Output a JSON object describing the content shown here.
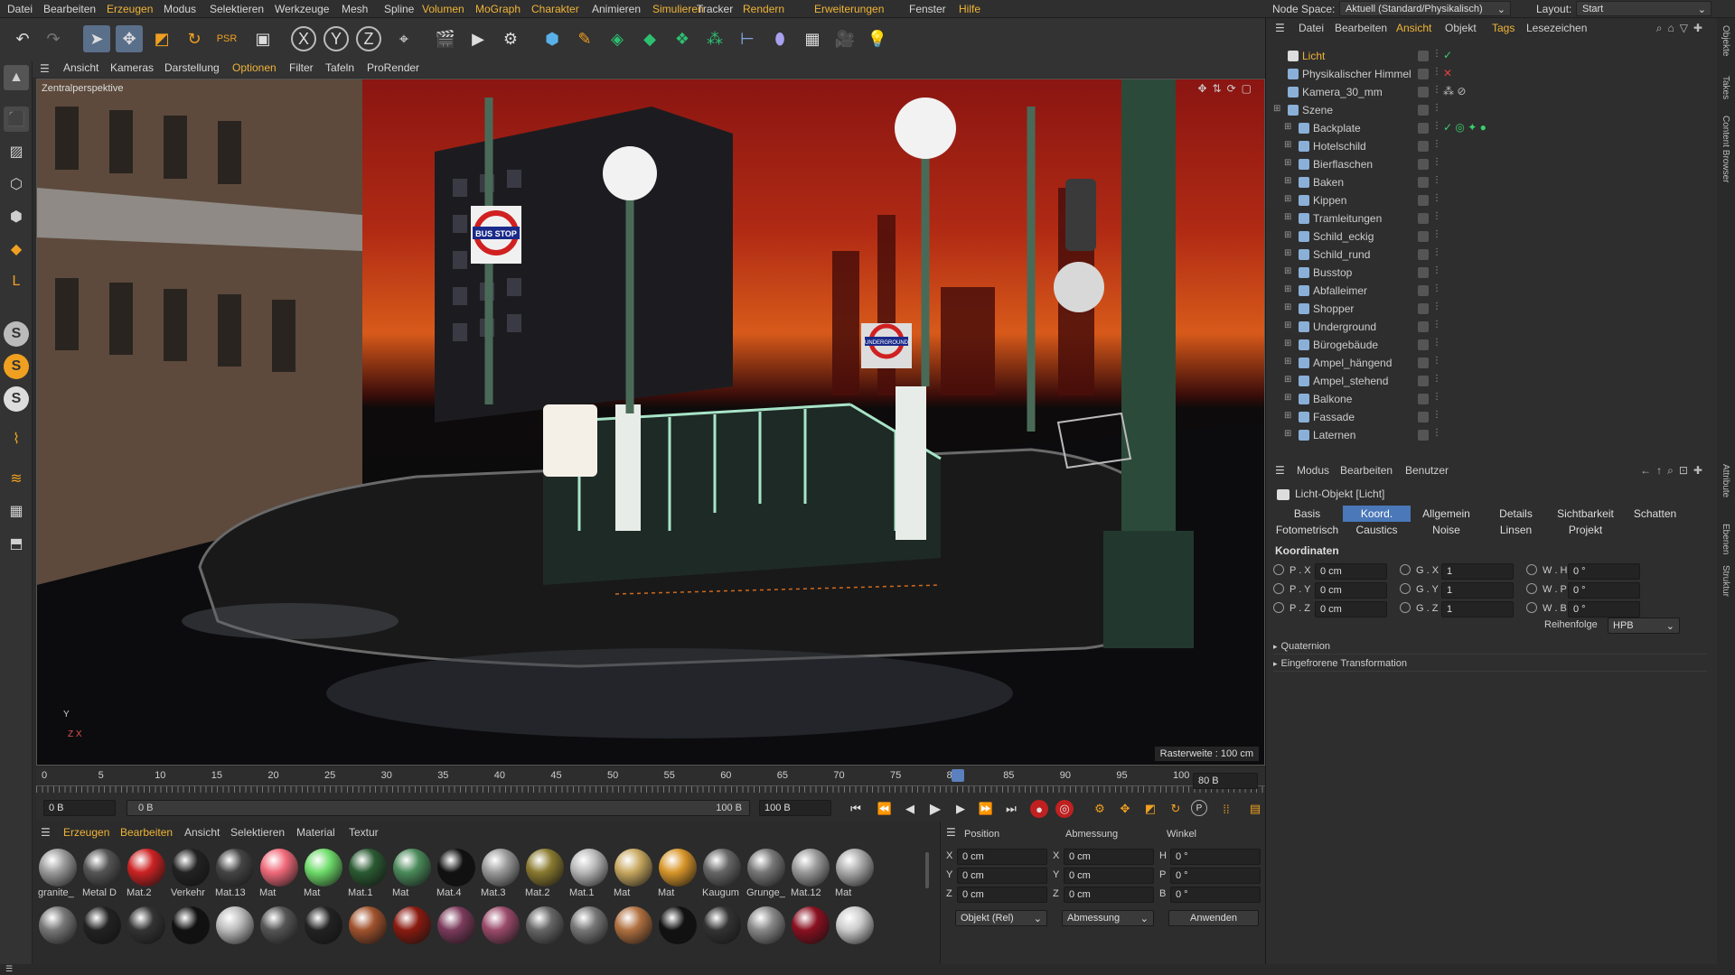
{
  "menubar": {
    "items": [
      {
        "label": "Datei",
        "hl": false
      },
      {
        "label": "Bearbeiten",
        "hl": false
      },
      {
        "label": "Erzeugen",
        "hl": true
      },
      {
        "label": "Modus",
        "hl": false
      },
      {
        "label": "Selektieren",
        "hl": false
      },
      {
        "label": "Werkzeuge",
        "hl": false
      },
      {
        "label": "Mesh",
        "hl": false
      },
      {
        "label": "Spline",
        "hl": false
      },
      {
        "label": "Volumen",
        "hl": true
      },
      {
        "label": "MoGraph",
        "hl": true
      },
      {
        "label": "Charakter",
        "hl": true
      },
      {
        "label": "Animieren",
        "hl": false
      },
      {
        "label": "Simulieren",
        "hl": true
      },
      {
        "label": "Tracker",
        "hl": false
      },
      {
        "label": "Rendern",
        "hl": true
      },
      {
        "label": "Erweiterungen",
        "hl": true
      },
      {
        "label": "Fenster",
        "hl": false
      },
      {
        "label": "Hilfe",
        "hl": true
      }
    ],
    "node_space_label": "Node Space:",
    "node_space_value": "Aktuell (Standard/Physikalisch)",
    "layout_label": "Layout:",
    "layout_value": "Start"
  },
  "viewport_menu": [
    "Ansicht",
    "Kameras",
    "Darstellung",
    "Optionen",
    "Filter",
    "Tafeln",
    "ProRender"
  ],
  "viewport": {
    "camera_label": "Zentralperspektive",
    "raster": "Rasterweite : 100 cm",
    "axis_y": "Y",
    "axis_zx": "Z X"
  },
  "scene_text": {
    "bus_stop": "BUS STOP",
    "underground": "UNDERGROUND"
  },
  "timeline": {
    "ticks": [
      "0",
      "5",
      "10",
      "15",
      "20",
      "25",
      "30",
      "35",
      "40",
      "45",
      "50",
      "55",
      "60",
      "65",
      "70",
      "75",
      "80",
      "85",
      "90",
      "95",
      "100"
    ],
    "current_frame": "80 B",
    "playhead_value": 80
  },
  "transport": {
    "start": "0 B",
    "range_start": "0 B",
    "range_end": "100 B",
    "end": "100 B"
  },
  "material_menu": [
    "Erzeugen",
    "Bearbeiten",
    "Ansicht",
    "Selektieren",
    "Material",
    "Textur"
  ],
  "materials_row1": [
    {
      "label": "granite_",
      "color": "#9a9a9a"
    },
    {
      "label": "Metal D",
      "color": "#555"
    },
    {
      "label": "Mat.2",
      "color": "#c22"
    },
    {
      "label": "Verkehr",
      "color": "#222"
    },
    {
      "label": "Mat.13",
      "color": "#444"
    },
    {
      "label": "Mat",
      "color": "#f06a7a"
    },
    {
      "label": "Mat",
      "color": "#6edc6a"
    },
    {
      "label": "Mat.1",
      "color": "#2a5a32"
    },
    {
      "label": "Mat",
      "color": "#4a8a5a"
    },
    {
      "label": "Mat.4",
      "color": "#111"
    },
    {
      "label": "Mat.3",
      "color": "#9a9a9a"
    },
    {
      "label": "Mat.2",
      "color": "#8a7a30"
    },
    {
      "label": "Mat.1",
      "color": "#b8b8b8"
    },
    {
      "label": "Mat",
      "color": "#c8a860"
    },
    {
      "label": "Mat",
      "color": "#d8962a"
    },
    {
      "label": "Kaugum",
      "color": "#666"
    },
    {
      "label": "Grunge_",
      "color": "#777"
    },
    {
      "label": "Mat.12",
      "color": "#999"
    },
    {
      "label": "Mat",
      "color": "#aaa"
    }
  ],
  "materials_row2_colors": [
    "#777",
    "#222",
    "#333",
    "#111",
    "#bbb",
    "#555",
    "#222",
    "#a0522d",
    "#8a1a10",
    "#7a3a5a",
    "#9a4a6a",
    "#666",
    "#777",
    "#b07040",
    "#111",
    "#333",
    "#888",
    "#8a1020",
    "#ccc"
  ],
  "coords": {
    "headers": [
      "Position",
      "Abmessung",
      "Winkel"
    ],
    "rows": [
      {
        "a": "X",
        "v1": "0 cm",
        "b": "X",
        "v2": "0 cm",
        "c": "H",
        "v3": "0 °"
      },
      {
        "a": "Y",
        "v1": "0 cm",
        "b": "Y",
        "v2": "0 cm",
        "c": "P",
        "v3": "0 °"
      },
      {
        "a": "Z",
        "v1": "0 cm",
        "b": "Z",
        "v2": "0 cm",
        "c": "B",
        "v3": "0 °"
      }
    ],
    "mode": "Objekt (Rel)",
    "size_mode": "Abmessung",
    "apply": "Anwenden"
  },
  "object_manager": {
    "menu": [
      "Datei",
      "Bearbeiten",
      "Ansicht",
      "Objekt",
      "Tags",
      "Lesezeichen"
    ],
    "objects": [
      {
        "name": "Licht",
        "color": "#f0b437",
        "indent": 0
      },
      {
        "name": "Physikalischer Himmel",
        "color": "#ccc",
        "indent": 0
      },
      {
        "name": "Kamera_30_mm",
        "color": "#ccc",
        "indent": 0
      },
      {
        "name": "Szene",
        "color": "#ccc",
        "indent": 0
      },
      {
        "name": "Backplate",
        "color": "#ccc",
        "indent": 1
      },
      {
        "name": "Hotelschild",
        "color": "#ccc",
        "indent": 1
      },
      {
        "name": "Bierflaschen",
        "color": "#ccc",
        "indent": 1
      },
      {
        "name": "Baken",
        "color": "#ccc",
        "indent": 1
      },
      {
        "name": "Kippen",
        "color": "#ccc",
        "indent": 1
      },
      {
        "name": "Tramleitungen",
        "color": "#ccc",
        "indent": 1
      },
      {
        "name": "Schild_eckig",
        "color": "#ccc",
        "indent": 1
      },
      {
        "name": "Schild_rund",
        "color": "#ccc",
        "indent": 1
      },
      {
        "name": "Busstop",
        "color": "#ccc",
        "indent": 1
      },
      {
        "name": "Abfalleimer",
        "color": "#ccc",
        "indent": 1
      },
      {
        "name": "Shopper",
        "color": "#ccc",
        "indent": 1
      },
      {
        "name": "Underground",
        "color": "#ccc",
        "indent": 1
      },
      {
        "name": "Bürogebäude",
        "color": "#ccc",
        "indent": 1
      },
      {
        "name": "Ampel_hängend",
        "color": "#ccc",
        "indent": 1
      },
      {
        "name": "Ampel_stehend",
        "color": "#ccc",
        "indent": 1
      },
      {
        "name": "Balkone",
        "color": "#ccc",
        "indent": 1
      },
      {
        "name": "Fassade",
        "color": "#ccc",
        "indent": 1
      },
      {
        "name": "Laternen",
        "color": "#ccc",
        "indent": 1
      }
    ]
  },
  "attribute_manager": {
    "menu": [
      "Modus",
      "Bearbeiten",
      "Benutzer"
    ],
    "object_title": "Licht-Objekt [Licht]",
    "tabs_row1": [
      {
        "label": "Basis",
        "on": false
      },
      {
        "label": "Koord.",
        "on": true
      },
      {
        "label": "Allgemein",
        "on": false
      },
      {
        "label": "Details",
        "on": false
      },
      {
        "label": "Sichtbarkeit",
        "on": false
      },
      {
        "label": "Schatten",
        "on": false
      }
    ],
    "tabs_row2": [
      "Fotometrisch",
      "Caustics",
      "Noise",
      "Linsen",
      "Projekt"
    ],
    "section": "Koordinaten",
    "coord_rows": [
      {
        "p": "P . X",
        "pv": "0 cm",
        "g": "G . X",
        "gv": "1",
        "w": "W . H",
        "wv": "0 °"
      },
      {
        "p": "P . Y",
        "pv": "0 cm",
        "g": "G . Y",
        "gv": "1",
        "w": "W . P",
        "wv": "0 °"
      },
      {
        "p": "P . Z",
        "pv": "0 cm",
        "g": "G . Z",
        "gv": "1",
        "w": "W . B",
        "wv": "0 °"
      }
    ],
    "order_label": "Reihenfolge",
    "order_value": "HPB",
    "collapsibles": [
      "Quaternion",
      "Eingefrorene Transformation"
    ]
  },
  "right_strip": [
    "Objekte",
    "Takes",
    "Content Browser",
    "Attribute",
    "Ebenen",
    "Struktur"
  ],
  "colors": {
    "accent": "#f0b437",
    "selection": "#4a78b8",
    "sky_top": "#8a1512",
    "sky_glow": "#d85a1a"
  }
}
